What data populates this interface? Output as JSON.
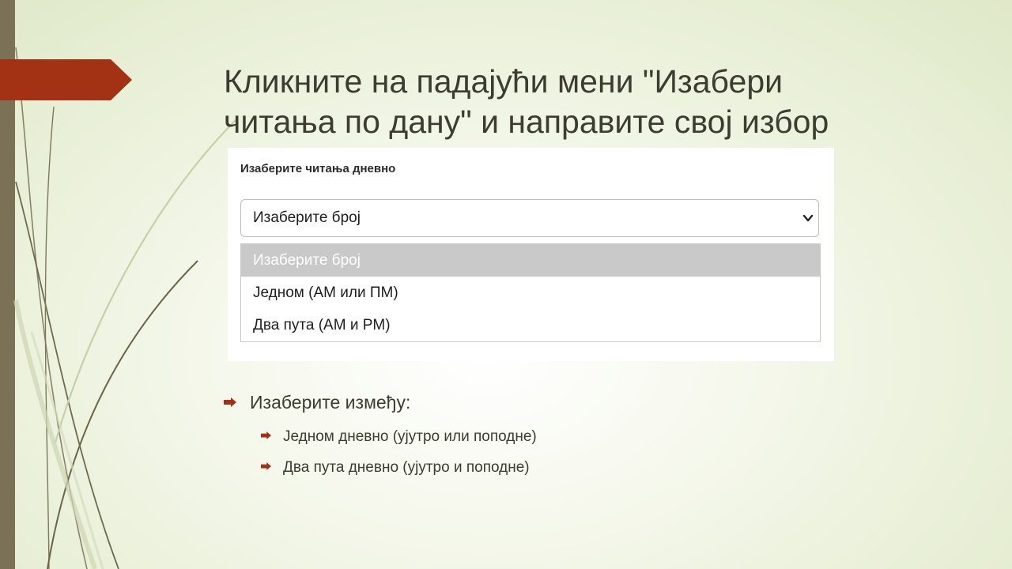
{
  "slide": {
    "title_line1": "Кликните на падајући мени \"Изабери",
    "title_line2": "читања по дану\" и направите свој избор",
    "colors": {
      "accent": "#a33214",
      "bar": "#7a7156",
      "text": "#3c3c30"
    }
  },
  "screenshot": {
    "label": "Изаберите читања дневно",
    "select_value": "Изаберите број",
    "options": [
      {
        "label": "Изаберите број",
        "selected": true
      },
      {
        "label": "Једном (АМ или ПМ)",
        "selected": false
      },
      {
        "label": "Два пута (АМ и PM)",
        "selected": false
      }
    ]
  },
  "bullets": {
    "main": "Изаберите између:",
    "sub": [
      "Једном дневно (ујутро или поподне)",
      "Два пута дневно (ујутро и поподне)"
    ],
    "icon": "arrow-bullet-icon"
  }
}
